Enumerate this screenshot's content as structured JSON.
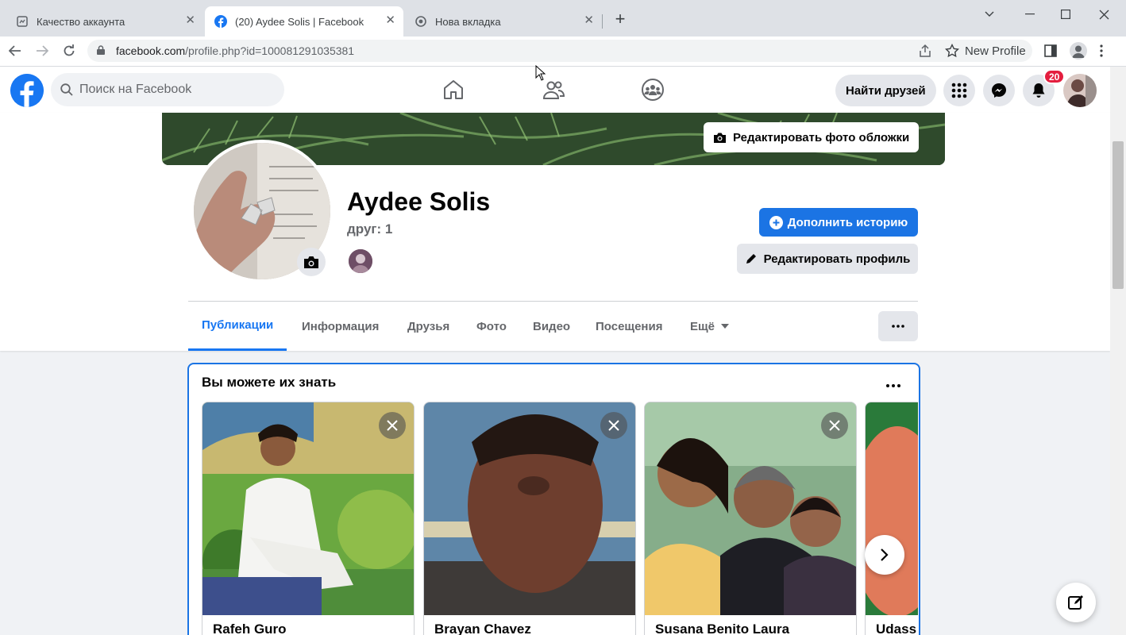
{
  "browser": {
    "tabs": [
      {
        "title": "Качество аккаунта"
      },
      {
        "title": "(20) Aydee Solis | Facebook"
      },
      {
        "title": "Нова вкладка"
      }
    ],
    "url_host": "facebook.com",
    "url_path": "/profile.php?id=100081291035381",
    "profile_label": "New Profile"
  },
  "fb": {
    "search_placeholder": "Поиск на Facebook",
    "find_friends": "Найти друзей",
    "notif_count": "20",
    "brand_color": "#1877f2"
  },
  "profile": {
    "edit_cover": "Редактировать фото обложки",
    "name": "Aydee Solis",
    "friends": "друг: 1",
    "add_story": "Дополнить историю",
    "edit_profile": "Редактировать профиль",
    "tabs": [
      "Публикации",
      "Информация",
      "Друзья",
      "Фото",
      "Видео",
      "Посещения",
      "Ещё"
    ]
  },
  "pymk": {
    "title": "Вы можете их знать",
    "people": [
      {
        "name": "Rafeh Guro"
      },
      {
        "name": "Brayan Chavez"
      },
      {
        "name": "Susana Benito Laura"
      },
      {
        "name": "Udass"
      }
    ]
  }
}
